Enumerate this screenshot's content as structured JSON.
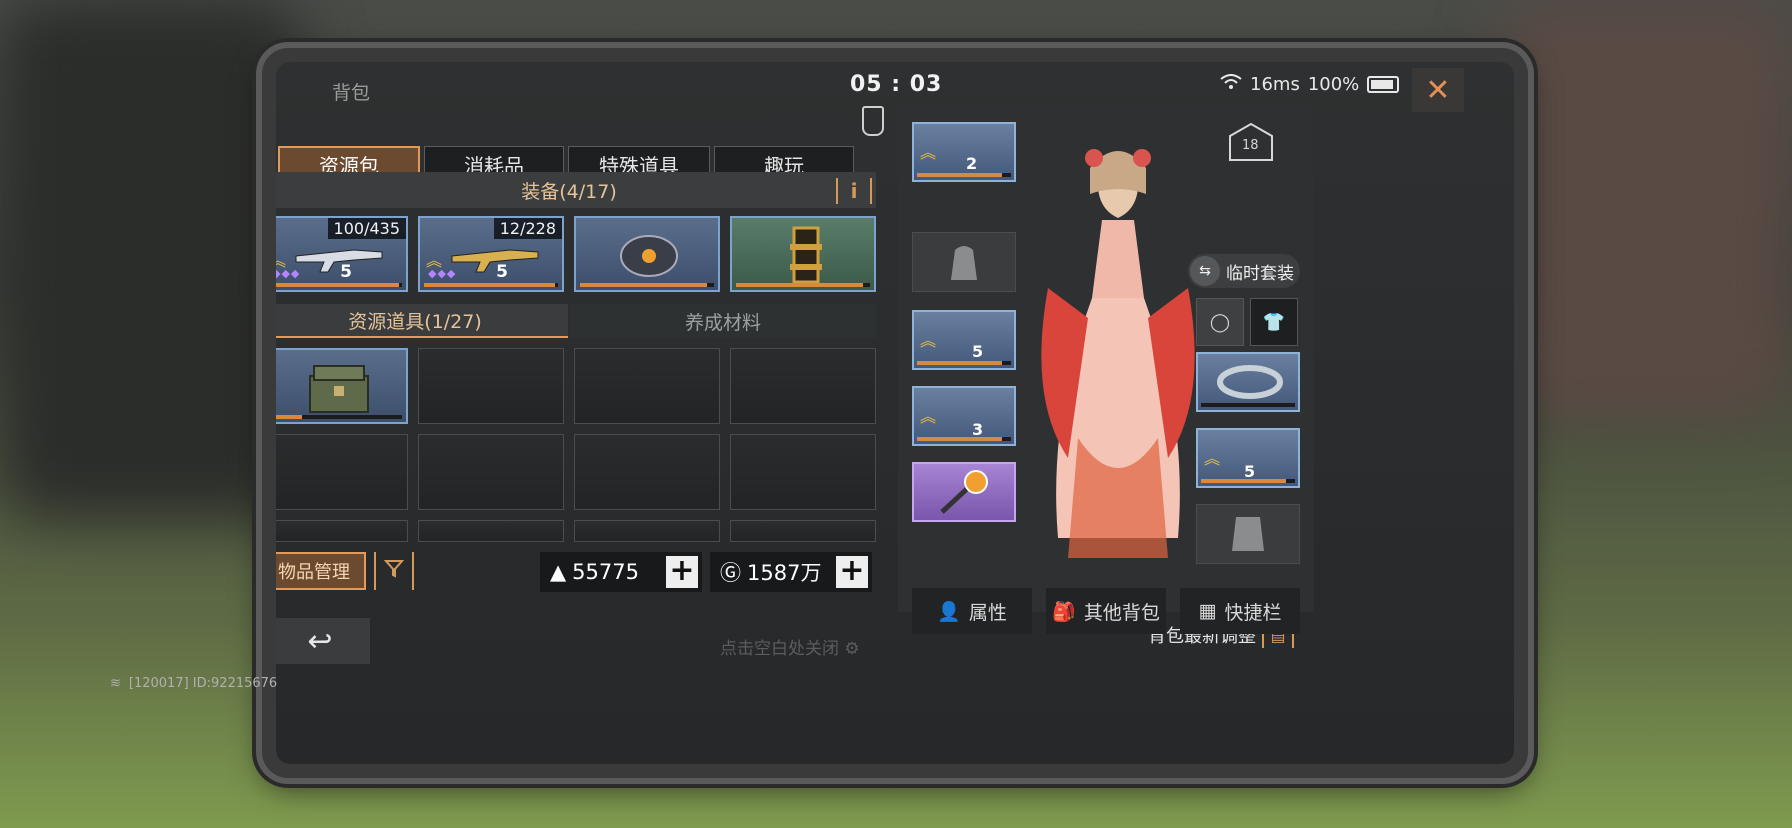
{
  "window": {
    "title": "背包",
    "clock": "05 : 03",
    "ping": "16ms",
    "battery": "100%"
  },
  "tabs": [
    {
      "label": "资源包",
      "active": true
    },
    {
      "label": "消耗品",
      "active": false
    },
    {
      "label": "特殊道具",
      "active": false
    },
    {
      "label": "趣玩",
      "active": false
    }
  ],
  "equipment_section": {
    "title": "装备(4/17)",
    "info_icon": "i"
  },
  "equipment_items": [
    {
      "name": "weapon-1",
      "counter": "100/435",
      "level": "5",
      "progress": 0.98
    },
    {
      "name": "weapon-2",
      "counter": "12/228",
      "level": "5",
      "progress": 0.98
    },
    {
      "name": "armor-piece",
      "counter": "",
      "level": "",
      "progress": 0.95
    },
    {
      "name": "cylinder-item",
      "counter": "",
      "level": "",
      "progress": 0.95
    }
  ],
  "subtabs": [
    {
      "label": "资源道具(1/27)",
      "active": true
    },
    {
      "label": "养成材料",
      "active": false
    }
  ],
  "resource_item": {
    "name": "supply-crate",
    "progress": 0.25
  },
  "bottom": {
    "manage_label": "物品管理",
    "filter_icon": "filter-icon",
    "currency1": "55775",
    "currency2": "1587万",
    "back_icon": "↩",
    "close_hint": "点击空白处关闭",
    "notice": "背包最新调整"
  },
  "right_panel": {
    "helmet_level": "2",
    "vest_level": "5",
    "weapon_level": "3",
    "knife_level": "5",
    "vip_level": "18",
    "temp_suit_label": "临时套装",
    "buttons": [
      {
        "label": "属性"
      },
      {
        "label": "其他背包"
      },
      {
        "label": "快捷栏"
      }
    ]
  },
  "footer_id": "[120017] ID:92215676",
  "colors": {
    "accent": "#e19a5c",
    "rarity_blue": "#7da2cc",
    "rarity_purple": "#c7a4f0"
  }
}
